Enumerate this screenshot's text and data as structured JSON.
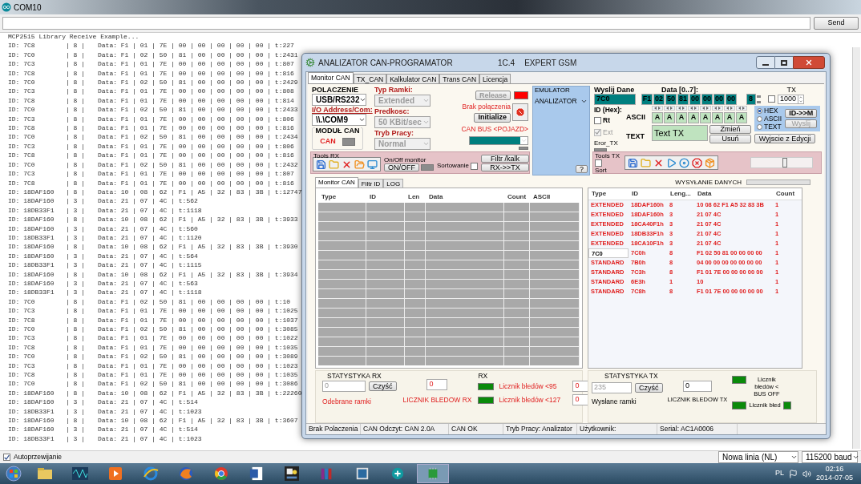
{
  "serial_monitor": {
    "title": "COM10",
    "send_button": "Send",
    "header": "MCP2515 Library Receive Example...",
    "lines": [
      {
        "id": "ID: 7C8",
        "len": "| 8 |",
        "data": "Data: F1 | 01 | 7E | 00 | 00 | 00 | 00 | 00 | t:227"
      },
      {
        "id": "ID: 7C0",
        "len": "| 8 |",
        "data": "Data: F1 | 02 | 50 | 81 | 00 | 00 | 00 | 00 | t:2431"
      },
      {
        "id": "ID: 7C3",
        "len": "| 8 |",
        "data": "Data: F1 | 01 | 7E | 00 | 00 | 00 | 00 | 00 | t:807"
      },
      {
        "id": "ID: 7C8",
        "len": "| 8 |",
        "data": "Data: F1 | 01 | 7E | 00 | 00 | 00 | 00 | 00 | t:816"
      },
      {
        "id": "ID: 7C0",
        "len": "| 8 |",
        "data": "Data: F1 | 02 | 50 | 81 | 00 | 00 | 00 | 00 | t:2429"
      },
      {
        "id": "ID: 7C3",
        "len": "| 8 |",
        "data": "Data: F1 | 01 | 7E | 00 | 00 | 00 | 00 | 00 | t:808"
      },
      {
        "id": "ID: 7C8",
        "len": "| 8 |",
        "data": "Data: F1 | 01 | 7E | 00 | 00 | 00 | 00 | 00 | t:814"
      },
      {
        "id": "ID: 7C0",
        "len": "| 8 |",
        "data": "Data: F1 | 02 | 50 | 81 | 00 | 00 | 00 | 00 | t:2433"
      },
      {
        "id": "ID: 7C3",
        "len": "| 8 |",
        "data": "Data: F1 | 01 | 7E | 00 | 00 | 00 | 00 | 00 | t:806"
      },
      {
        "id": "ID: 7C8",
        "len": "| 8 |",
        "data": "Data: F1 | 01 | 7E | 00 | 00 | 00 | 00 | 00 | t:816"
      },
      {
        "id": "ID: 7C0",
        "len": "| 8 |",
        "data": "Data: F1 | 02 | 50 | 81 | 00 | 00 | 00 | 00 | t:2434"
      },
      {
        "id": "ID: 7C3",
        "len": "| 8 |",
        "data": "Data: F1 | 01 | 7E | 00 | 00 | 00 | 00 | 00 | t:806"
      },
      {
        "id": "ID: 7C8",
        "len": "| 8 |",
        "data": "Data: F1 | 01 | 7E | 00 | 00 | 00 | 00 | 00 | t:816"
      },
      {
        "id": "ID: 7C0",
        "len": "| 8 |",
        "data": "Data: F1 | 02 | 50 | 81 | 00 | 00 | 00 | 00 | t:2432"
      },
      {
        "id": "ID: 7C3",
        "len": "| 8 |",
        "data": "Data: F1 | 01 | 7E | 00 | 00 | 00 | 00 | 00 | t:807"
      },
      {
        "id": "ID: 7C8",
        "len": "| 8 |",
        "data": "Data: F1 | 01 | 7E | 00 | 00 | 00 | 00 | 00 | t:816"
      },
      {
        "id": "ID: 18DAF160",
        "len": "| 8 |",
        "data": "Data: 10 | 08 | 62 | F1 | A5 | 32 | 83 | 3B | t:12747"
      },
      {
        "id": "ID: 18DAF160",
        "len": "| 3 |",
        "data": "Data: 21 | 07 | 4C | t:562"
      },
      {
        "id": "ID: 18DB33F1",
        "len": "| 3 |",
        "data": "Data: 21 | 07 | 4C | t:1118"
      },
      {
        "id": "ID: 18DAF160",
        "len": "| 8 |",
        "data": "Data: 10 | 08 | 62 | F1 | A5 | 32 | 83 | 3B | t:3933"
      },
      {
        "id": "ID: 18DAF160",
        "len": "| 3 |",
        "data": "Data: 21 | 07 | 4C | t:560"
      },
      {
        "id": "ID: 18DB33F1",
        "len": "| 3 |",
        "data": "Data: 21 | 07 | 4C | t:1120"
      },
      {
        "id": "ID: 18DAF160",
        "len": "| 8 |",
        "data": "Data: 10 | 08 | 62 | F1 | A5 | 32 | 83 | 3B | t:3930"
      },
      {
        "id": "ID: 18DAF160",
        "len": "| 3 |",
        "data": "Data: 21 | 07 | 4C | t:564"
      },
      {
        "id": "ID: 18DB33F1",
        "len": "| 3 |",
        "data": "Data: 21 | 07 | 4C | t:1115"
      },
      {
        "id": "ID: 18DAF160",
        "len": "| 8 |",
        "data": "Data: 10 | 08 | 62 | F1 | A5 | 32 | 83 | 3B | t:3934"
      },
      {
        "id": "ID: 18DAF160",
        "len": "| 3 |",
        "data": "Data: 21 | 07 | 4C | t:563"
      },
      {
        "id": "ID: 18DB33F1",
        "len": "| 3 |",
        "data": "Data: 21 | 07 | 4C | t:1118"
      },
      {
        "id": "ID: 7C0",
        "len": "| 8 |",
        "data": "Data: F1 | 02 | 50 | 81 | 00 | 00 | 00 | 00 | t:10"
      },
      {
        "id": "ID: 7C3",
        "len": "| 8 |",
        "data": "Data: F1 | 01 | 7E | 00 | 00 | 00 | 00 | 00 | t:1025"
      },
      {
        "id": "ID: 7C8",
        "len": "| 8 |",
        "data": "Data: F1 | 01 | 7E | 00 | 00 | 00 | 00 | 00 | t:1037"
      },
      {
        "id": "ID: 7C0",
        "len": "| 8 |",
        "data": "Data: F1 | 02 | 50 | 81 | 00 | 00 | 00 | 00 | t:3085"
      },
      {
        "id": "ID: 7C3",
        "len": "| 8 |",
        "data": "Data: F1 | 01 | 7E | 00 | 00 | 00 | 00 | 00 | t:1022"
      },
      {
        "id": "ID: 7C8",
        "len": "| 8 |",
        "data": "Data: F1 | 01 | 7E | 00 | 00 | 00 | 00 | 00 | t:1035"
      },
      {
        "id": "ID: 7C0",
        "len": "| 8 |",
        "data": "Data: F1 | 02 | 50 | 81 | 00 | 00 | 00 | 00 | t:3089"
      },
      {
        "id": "ID: 7C3",
        "len": "| 8 |",
        "data": "Data: F1 | 01 | 7E | 00 | 00 | 00 | 00 | 00 | t:1023"
      },
      {
        "id": "ID: 7C8",
        "len": "| 8 |",
        "data": "Data: F1 | 01 | 7E | 00 | 00 | 00 | 00 | 00 | t:1035"
      },
      {
        "id": "ID: 7C0",
        "len": "| 8 |",
        "data": "Data: F1 | 02 | 50 | 81 | 00 | 00 | 00 | 00 | t:3086"
      },
      {
        "id": "ID: 18DAF160",
        "len": "| 8 |",
        "data": "Data: 10 | 08 | 62 | F1 | A5 | 32 | 83 | 3B | t:22260"
      },
      {
        "id": "ID: 18DAF160",
        "len": "| 3 |",
        "data": "Data: 21 | 07 | 4C | t:514"
      },
      {
        "id": "ID: 18DB33F1",
        "len": "| 3 |",
        "data": "Data: 21 | 07 | 4C | t:1023"
      },
      {
        "id": "ID: 18DAF160",
        "len": "| 8 |",
        "data": "Data: 10 | 08 | 62 | F1 | A5 | 32 | 83 | 3B | t:3607"
      },
      {
        "id": "ID: 18DAF160",
        "len": "| 3 |",
        "data": "Data: 21 | 07 | 4C | t:514"
      },
      {
        "id": "ID: 18DB33F1",
        "len": "| 3 |",
        "data": "Data: 21 | 07 | 4C | t:1023"
      }
    ],
    "autoscroll": {
      "label": "Autoprzewijanie",
      "checked": true
    },
    "line_ending": "Nowa linia (NL)",
    "baud": "115200 baud"
  },
  "dialog": {
    "title": "ANALIZATOR CAN-PROGRAMATOR",
    "version": "1C.4",
    "brand": "EXPERT GSM",
    "tabs": [
      {
        "label": "Monitor CAN",
        "selected": true
      },
      {
        "label": "TX_CAN",
        "selected": false
      },
      {
        "label": "Kalkulator CAN",
        "selected": false
      },
      {
        "label": "Trans CAN",
        "selected": false
      },
      {
        "label": "Licencja",
        "selected": false
      }
    ],
    "connection": {
      "label": "POLACZENIE",
      "interface": "USB/RS232",
      "address_label": "I/O Address/Com:",
      "address": "\\\\.\\COM9",
      "module_title": "MODUŁ CAN",
      "module_label": "CAN",
      "module_led": {
        "color": "#8c8c8c"
      }
    },
    "frame": {
      "type_label": "Typ Ramki:",
      "type": {
        "value": "Extended",
        "disabled": true
      },
      "speed_label": "Predkosc:",
      "speed": {
        "value": "50 KBit/sec",
        "disabled": true
      },
      "mode_label": "Tryb Pracy:",
      "mode": {
        "value": "Normal",
        "disabled": true
      }
    },
    "link": {
      "release": {
        "label": "Release",
        "disabled": true
      },
      "release_led": {
        "color": "#ff0000"
      },
      "status": "Brak połączenia",
      "initialize": "Initialize",
      "bus_label": "CAN BUS <POJAZD>",
      "bus_led": {
        "color": "#8c8c8c"
      }
    },
    "emulator": {
      "title": "EMULATOR",
      "mode": "ANALIZATOR",
      "help": "?"
    },
    "tools_rx": {
      "title": "Tools RX",
      "monitor_label": "On/Off monitor",
      "monitor_button": "ON/OFF",
      "monitor_led": {
        "color": "#8c8c8c"
      },
      "sort_label": "Sortowanie",
      "sort_checked": false,
      "filter_button": "Filtr /kalk",
      "rx_tx_button": "RX->>TX"
    },
    "sub_tabs": [
      {
        "label": "Monitor CAN",
        "selected": true
      },
      {
        "label": "Filtr ID",
        "selected": false
      },
      {
        "label": "LOG",
        "selected": false
      }
    ],
    "rx_table": {
      "columns": [
        "Type",
        "ID",
        "Len",
        "Data",
        "Count",
        "ASCII"
      ]
    },
    "send": {
      "title": "Wyslij Dane",
      "id_value": "7C0",
      "id_label": "ID (Hex):",
      "data_label": "Data [0..7]:",
      "data": [
        "F1",
        "02",
        "50",
        "81",
        "00",
        "00",
        "00",
        "00"
      ],
      "dlc": "8",
      "tx_label": "TX",
      "tx_checked": false,
      "interval": "1000",
      "rt": {
        "label": "Rt",
        "checked": false
      },
      "ext": {
        "label": "Ext",
        "checked": true,
        "disabled": true
      },
      "error_label": "Eror_TX",
      "error_led": {
        "color": "#8c8c8c"
      },
      "ascii_label": "ASCII",
      "ascii": [
        "A",
        "A",
        "A",
        "A",
        "A",
        "A",
        "A",
        "A"
      ],
      "text_label": "TEXT",
      "text_value": "Text TX",
      "change_button": "Zmień",
      "delete_button": "Usuń",
      "formats": [
        {
          "label": "HEX",
          "selected": true
        },
        {
          "label": "ASCII",
          "selected": false
        },
        {
          "label": "TEXT",
          "selected": false
        }
      ],
      "id_to_m_button": "ID->>M",
      "send_button": {
        "label": "Wyslij",
        "disabled": true
      },
      "exit_button": "Wyjscie z Edycji"
    },
    "tools_tx": {
      "title": "Tools TX",
      "sort_label": "Sort",
      "sort_checked": false,
      "slider": {
        "level": 0.55
      }
    },
    "sending": {
      "label": "WYSYŁANIE DANYCH",
      "level": 0
    },
    "tx_table": {
      "columns": [
        "Type",
        "ID",
        "Leng...",
        "Data",
        "Count"
      ],
      "rows": [
        {
          "type": "EXTENDED",
          "id": "18DAF160h",
          "len": "8",
          "data": "10 08 62 F1 A5 32 83 3B",
          "count": "1",
          "editing": false
        },
        {
          "type": "EXTENDED",
          "id": "18DAF160h",
          "len": "3",
          "data": "21 07 4C",
          "count": "1",
          "editing": false
        },
        {
          "type": "EXTENDED",
          "id": "18CA40F1h",
          "len": "3",
          "data": "21 07 4C",
          "count": "1",
          "editing": false
        },
        {
          "type": "EXTENDED",
          "id": "18DB33F1h",
          "len": "3",
          "data": "21 07 4C",
          "count": "1",
          "editing": false
        },
        {
          "type": "EXTENDED",
          "id": "18CA10F1h",
          "len": "3",
          "data": "21 07 4C",
          "count": "1",
          "editing": false
        },
        {
          "type": "7C0",
          "id": "7C0h",
          "len": "8",
          "data": "F1 02 50 81 00 00 00 00",
          "count": "1",
          "editing": true
        },
        {
          "type": "STANDARD",
          "id": "7B0h",
          "len": "8",
          "data": "04 00 00 00 00 00 00 00",
          "count": "1",
          "editing": false
        },
        {
          "type": "STANDARD",
          "id": "7C3h",
          "len": "8",
          "data": "F1 01 7E 00 00 00 00 00",
          "count": "1",
          "editing": false
        },
        {
          "type": "STANDARD",
          "id": "6E3h",
          "len": "1",
          "data": "10",
          "count": "1",
          "editing": false
        },
        {
          "type": "STANDARD",
          "id": "7C8h",
          "len": "8",
          "data": "F1 01 7E 00 00 00 00 00",
          "count": "1",
          "editing": false
        }
      ]
    },
    "rx_stats": {
      "title": "STATYSTYKA RX",
      "frames": "0",
      "clear_button": "Czyść",
      "frames_label": "Odebrane ramki",
      "errors": "0",
      "errors_label": "LICZNIK BLEDOW RX",
      "group": "RX",
      "counters": [
        {
          "label": "Licznik błedów <95",
          "color": "#0a8a0a",
          "value": "0"
        },
        {
          "label": "Licznik błedów <127",
          "color": "#0a8a0a",
          "value": "0"
        }
      ]
    },
    "tx_stats": {
      "title": "STATYSTYKA TX",
      "frames": "235",
      "clear_button": "Czyść",
      "frames_label": "Wysłane ramki",
      "errors": "0",
      "errors_label": "LICZNIK BLEDOW TX",
      "counters": [
        {
          "label": "Licznik błedów < BUS OFF",
          "color": "#0a8a0a"
        },
        {
          "label": "Licznik błed",
          "color": "#0a8a0a"
        }
      ]
    },
    "status_bar": [
      "Brak Polaczenia",
      "CAN Odczyt: CAN 2.0A",
      "CAN OK",
      "Tryb Pracy: Analizator",
      "Użytkownik:",
      "Serial: AC1A0006"
    ]
  },
  "taskbar": {
    "language": "PL",
    "time": "02:16",
    "date": "2014-07-05"
  }
}
